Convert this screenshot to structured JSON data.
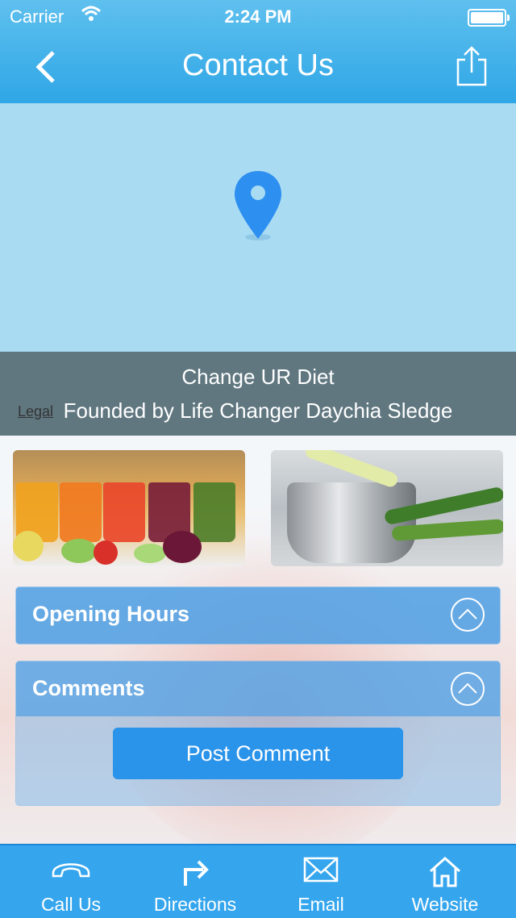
{
  "status_bar": {
    "carrier": "Carrier",
    "time": "2:24 PM"
  },
  "header": {
    "title": "Contact Us",
    "back_icon": "chevron-left-icon",
    "share_icon": "share-icon"
  },
  "map": {
    "pin_icon": "map-pin-icon",
    "legal_label": "Legal",
    "title": "Change UR Diet",
    "subtitle": "Founded by Life Changer Daychia Sledge"
  },
  "photos": [
    {
      "name": "juice-glasses-photo"
    },
    {
      "name": "cooking-pot-leeks-photo"
    }
  ],
  "sections": {
    "opening_hours": {
      "title": "Opening Hours",
      "icon": "chevron-up-circle-icon"
    },
    "comments": {
      "title": "Comments",
      "icon": "chevron-up-circle-icon",
      "button": "Post Comment"
    }
  },
  "tabbar": {
    "items": [
      {
        "label": "Call Us",
        "icon": "phone-icon"
      },
      {
        "label": "Directions",
        "icon": "turn-right-arrow-icon"
      },
      {
        "label": "Email",
        "icon": "envelope-icon"
      },
      {
        "label": "Website",
        "icon": "home-icon"
      }
    ]
  },
  "colors": {
    "header": "#2fa6e6",
    "map": "#a9dcf3",
    "accent": "#2a93ea",
    "tabbar": "#35a6ee"
  }
}
